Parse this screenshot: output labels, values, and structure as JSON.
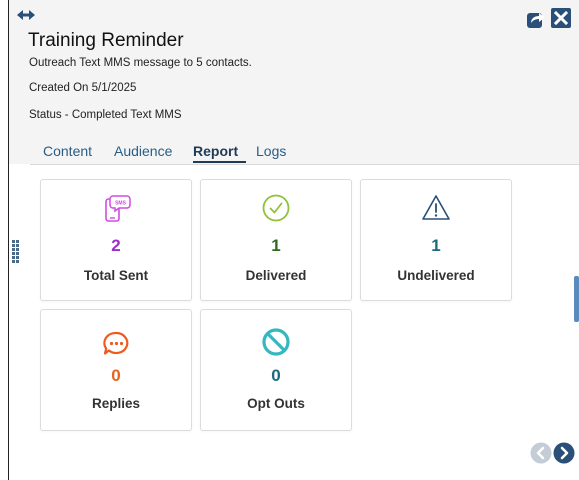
{
  "header": {
    "title": "Training Reminder",
    "subtitle": "Outreach Text MMS message to 5 contacts.",
    "created": "Created On 5/1/2025",
    "status": "Status - Completed Text MMS"
  },
  "tabs": [
    {
      "label": "Content",
      "active": false
    },
    {
      "label": "Audience",
      "active": false
    },
    {
      "label": "Report",
      "active": true
    },
    {
      "label": "Logs",
      "active": false
    }
  ],
  "stats": [
    {
      "label": "Total Sent",
      "value": "2",
      "icon": "sms-phone-icon",
      "color": "#9b30c8"
    },
    {
      "label": "Delivered",
      "value": "1",
      "icon": "check-circle-icon",
      "color": "#2f6b1f"
    },
    {
      "label": "Undelivered",
      "value": "1",
      "icon": "warning-triangle-icon",
      "color": "#1b6a80"
    },
    {
      "label": "Replies",
      "value": "0",
      "icon": "chat-bubble-icon",
      "color": "#e8641c"
    },
    {
      "label": "Opt Outs",
      "value": "0",
      "icon": "prohibited-icon",
      "color": "#1b6a80"
    }
  ],
  "icon_colors": {
    "sms": "#d04be0",
    "check": "#8fc13a",
    "warning": "#2a4f78",
    "chat": "#ef5a1f",
    "prohibited": "#33b8bf",
    "nav_prev": "#c4ccd6",
    "nav_next": "#2a4f78"
  }
}
